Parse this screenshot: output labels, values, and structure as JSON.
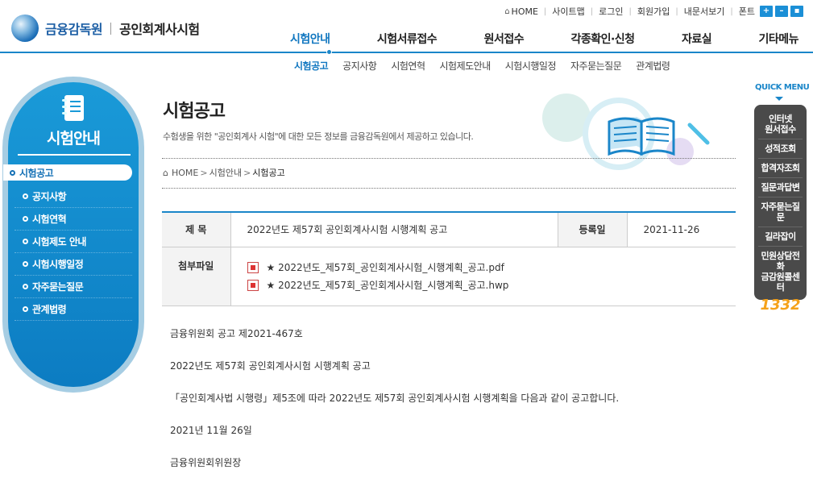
{
  "header": {
    "org_name": "금융감독원",
    "site_name": "공인회계사시험",
    "util_links": [
      "HOME",
      "사이트맵",
      "로그인",
      "회원가입",
      "내문서보기",
      "폰트"
    ],
    "font_buttons": [
      "+",
      "–",
      "▪"
    ]
  },
  "gnb": [
    "시험안내",
    "시험서류접수",
    "원서접수",
    "각종확인·신청",
    "자료실",
    "기타메뉴"
  ],
  "subnav": [
    "시험공고",
    "공지사항",
    "시험연혁",
    "시험제도안내",
    "시험시행일정",
    "자주묻는질문",
    "관계법령"
  ],
  "sidebar": {
    "title": "시험안내",
    "items": [
      "시험공고",
      "공지사항",
      "시험연혁",
      "시험제도 안내",
      "시험시행일정",
      "자주묻는질문",
      "관계법령"
    ]
  },
  "page": {
    "title": "시험공고",
    "description": "수험생을 위한 \"공인회계사 시험\"에 대한 모든 정보를 금융감독원에서 제공하고 있습니다.",
    "breadcrumb": [
      "HOME",
      "시험안내",
      "시험공고"
    ]
  },
  "post": {
    "subject_label": "제 목",
    "subject": "2022년도 제57회 공인회계사시험 시행계획 공고",
    "date_label": "등록일",
    "date": "2021-11-26",
    "attach_label": "첨부파일",
    "files": [
      "★ 2022년도_제57회_공인회계사시험_시행계획_공고.pdf",
      "★ 2022년도_제57회_공인회계사시험_시행계획_공고.hwp"
    ],
    "body": [
      "금융위원회 공고 제2021-467호",
      "2022년도 제57회 공인회계사시험 시행계획 공고",
      "「공인회계사법 시행령」제5조에 따라 2022년도 제57회 공인회계사시험 시행계획을 다음과 같이 공고합니다.",
      "2021년 11월 26일",
      "금융위원회위원장"
    ]
  },
  "quick_menu": {
    "title": "QUICK MENU",
    "items": [
      "인터넷\n원서접수",
      "성적조회",
      "합격자조회",
      "질문과답변",
      "자주묻는질문",
      "길라잡이",
      "민원상담전화\n금감원콜센터"
    ],
    "phone": "1332"
  },
  "colors": {
    "accent": "#1a86c9",
    "sidebar": "#0c7cc2",
    "quick_bg": "#4a4a4a",
    "phone": "#f5a21a"
  }
}
